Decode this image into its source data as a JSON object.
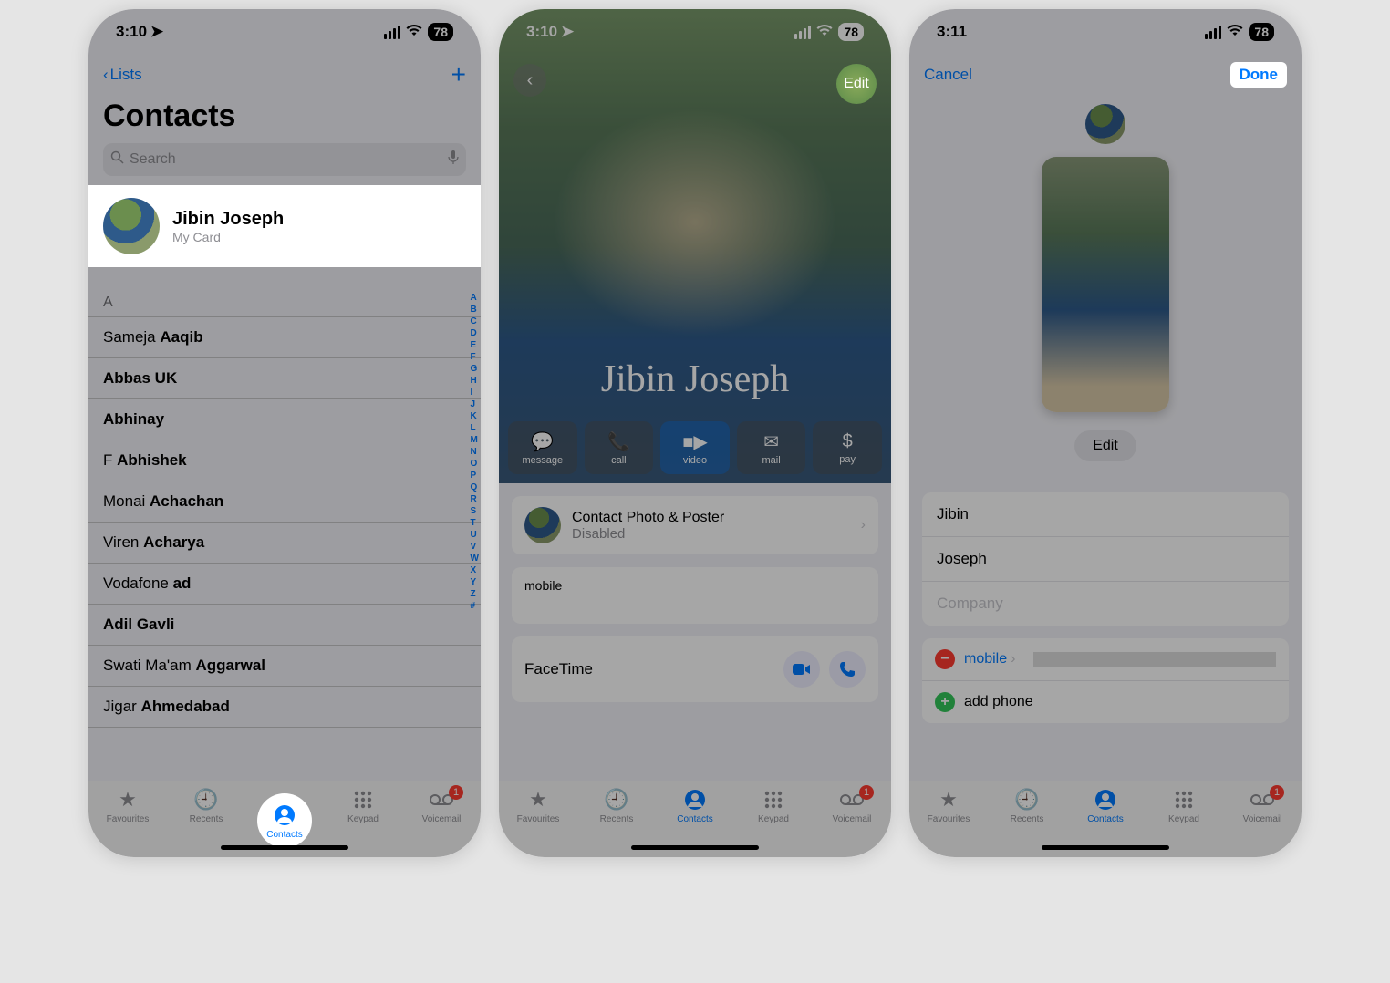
{
  "screen1": {
    "time": "3:10",
    "battery": "78",
    "back_label": "Lists",
    "title": "Contacts",
    "search_placeholder": "Search",
    "my_card": {
      "name": "Jibin Joseph",
      "sub": "My Card"
    },
    "section": "A",
    "contacts": [
      {
        "first": "Sameja ",
        "last": "Aaqib"
      },
      {
        "first": "",
        "last": "Abbas UK"
      },
      {
        "first": "",
        "last": "Abhinay"
      },
      {
        "first": "F ",
        "last": "Abhishek"
      },
      {
        "first": "Monai ",
        "last": "Achachan"
      },
      {
        "first": "Viren ",
        "last": "Acharya"
      },
      {
        "first": "Vodafone ",
        "last": "ad"
      },
      {
        "first": "",
        "last": "Adil Gavli"
      },
      {
        "first": "Swati Ma'am ",
        "last": "Aggarwal"
      },
      {
        "first": "Jigar ",
        "last": "Ahmedabad"
      }
    ],
    "index": [
      "A",
      "B",
      "C",
      "D",
      "E",
      "F",
      "G",
      "H",
      "I",
      "J",
      "K",
      "L",
      "M",
      "N",
      "O",
      "P",
      "Q",
      "R",
      "S",
      "T",
      "U",
      "V",
      "W",
      "X",
      "Y",
      "Z",
      "#"
    ]
  },
  "screen2": {
    "time": "3:10",
    "battery": "78",
    "edit": "Edit",
    "name": "Jibin Joseph",
    "actions": [
      {
        "label": "message"
      },
      {
        "label": "call"
      },
      {
        "label": "video"
      },
      {
        "label": "mail"
      },
      {
        "label": "pay"
      }
    ],
    "photo_poster": {
      "title": "Contact Photo & Poster",
      "sub": "Disabled"
    },
    "mobile_label": "mobile",
    "facetime": "FaceTime"
  },
  "screen3": {
    "time": "3:11",
    "battery": "78",
    "cancel": "Cancel",
    "done": "Done",
    "edit": "Edit",
    "first_name": "Jibin",
    "last_name": "Joseph",
    "company_placeholder": "Company",
    "mobile_label": "mobile",
    "add_phone": "add phone"
  },
  "tabs": {
    "favourites": "Favourites",
    "recents": "Recents",
    "contacts": "Contacts",
    "keypad": "Keypad",
    "voicemail": "Voicemail",
    "badge": "1"
  }
}
